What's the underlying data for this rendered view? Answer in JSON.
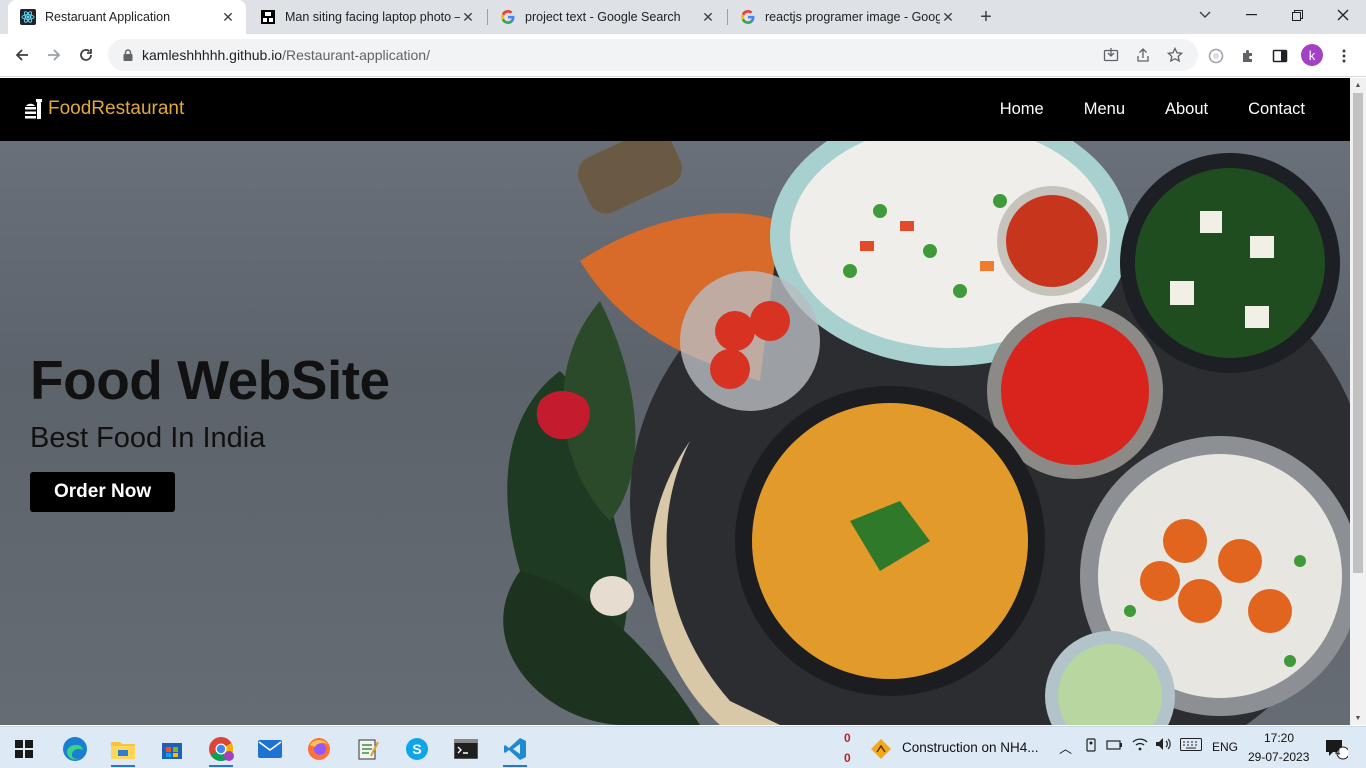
{
  "browser": {
    "tabs": [
      {
        "title": "Restaruant Application",
        "icon": "react-icon"
      },
      {
        "title": "Man siting facing laptop photo –",
        "icon": "unsplash-icon"
      },
      {
        "title": "project text - Google Search",
        "icon": "google-icon"
      },
      {
        "title": "reactjs programer image - Googl",
        "icon": "google-icon"
      }
    ],
    "url_host": "kamleshhhhh.github.io",
    "url_path": "/Restaurant-application/",
    "profile_initial": "k"
  },
  "site": {
    "brand": "FoodRestaurant",
    "nav": [
      "Home",
      "Menu",
      "About",
      "Contact"
    ],
    "hero": {
      "title": "Food WebSite",
      "subtitle": "Best Food In India",
      "cta": "Order Now"
    },
    "colors": {
      "brand": "#e2a93a",
      "navbar": "#000000"
    }
  },
  "taskbar": {
    "apps": [
      "windows-start-icon",
      "edge-icon",
      "file-explorer-icon",
      "store-icon",
      "chrome-icon",
      "mail-icon",
      "firefox-icon",
      "notepad-icon",
      "skype-icon",
      "terminal-icon",
      "vscode-icon"
    ],
    "counter_top": "0",
    "counter_bottom": "0",
    "news": "Construction on NH4...",
    "language": "ENG",
    "time": "17:20",
    "date": "29-07-2023",
    "notifications": "4"
  }
}
